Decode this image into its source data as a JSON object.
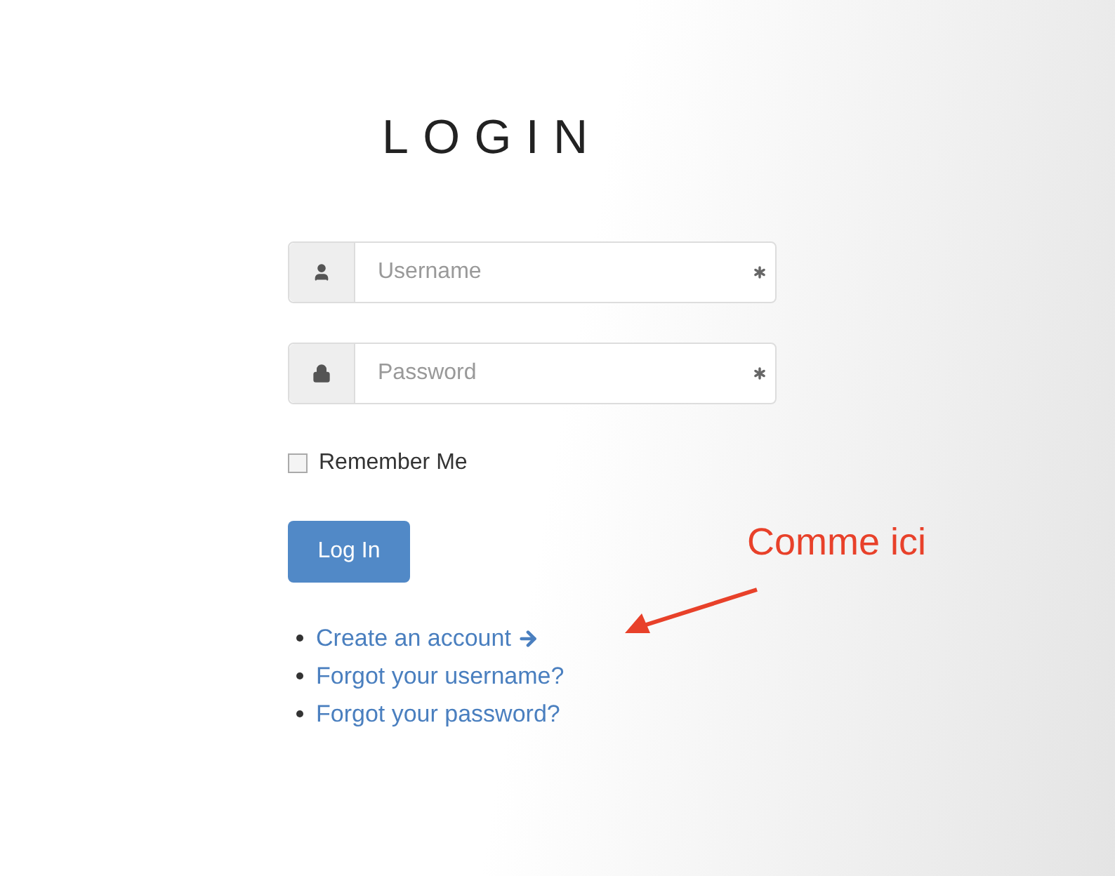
{
  "title": "LOGIN",
  "fields": [
    {
      "kind": "username",
      "placeholder": "Username",
      "required": true
    },
    {
      "kind": "password",
      "placeholder": "Password",
      "required": true
    }
  ],
  "remember": {
    "label": "Remember Me",
    "checked": false
  },
  "submit": "Log In",
  "links": [
    {
      "label": "Create an account",
      "arrow": true
    },
    {
      "label": "Forgot your username?",
      "arrow": false
    },
    {
      "label": "Forgot your password?",
      "arrow": false
    }
  ],
  "annotation": {
    "text": "Comme ici"
  }
}
